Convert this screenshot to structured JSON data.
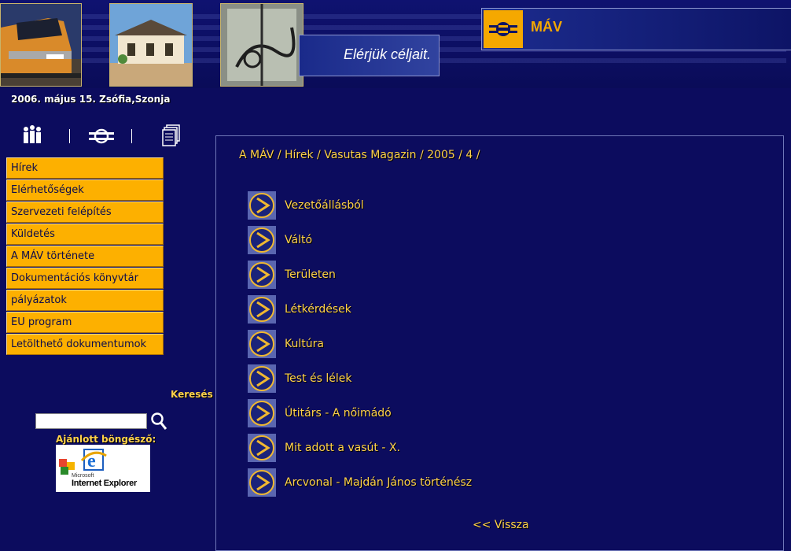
{
  "header": {
    "slogan": "Elérjük céljait.",
    "logo_text": "MÁV"
  },
  "date_line": "2006. május 15. Zsófia,Szonja",
  "icons": [
    "people-icon",
    "mav-emblem-icon",
    "documents-icon"
  ],
  "menu": {
    "items": [
      {
        "label": "Hírek"
      },
      {
        "label": "Elérhetőségek"
      },
      {
        "label": "Szervezeti felépítés"
      },
      {
        "label": "Küldetés"
      },
      {
        "label": "A MÁV története"
      },
      {
        "label": "Dokumentációs könyvtár"
      },
      {
        "label": "pályázatok"
      },
      {
        "label": "EU program"
      },
      {
        "label": "Letölthető dokumentumok"
      }
    ]
  },
  "search": {
    "label": "Keresés",
    "value": ""
  },
  "browser": {
    "label": "Ajánlott böngésző:",
    "ms_text": "Microsoft",
    "ie_text": "Internet Explorer"
  },
  "breadcrumb": {
    "items": [
      "A MÁV",
      "Hírek",
      "Vasutas Magazin",
      "2005",
      "4"
    ],
    "separator": " / "
  },
  "articles": [
    {
      "title": "Vezetőállásból"
    },
    {
      "title": "Váltó"
    },
    {
      "title": "Területen"
    },
    {
      "title": "Létkérdések"
    },
    {
      "title": "Kultúra"
    },
    {
      "title": "Test és lélek"
    },
    {
      "title": "Útitárs - A nőimádó"
    },
    {
      "title": "Mit adott a vasút - X."
    },
    {
      "title": "Arcvonal - Majdán János történész"
    }
  ],
  "back_link": "<< Vissza",
  "colors": {
    "background": "#0c0c5e",
    "menu": "#fdb000",
    "link": "#ffd24a"
  }
}
